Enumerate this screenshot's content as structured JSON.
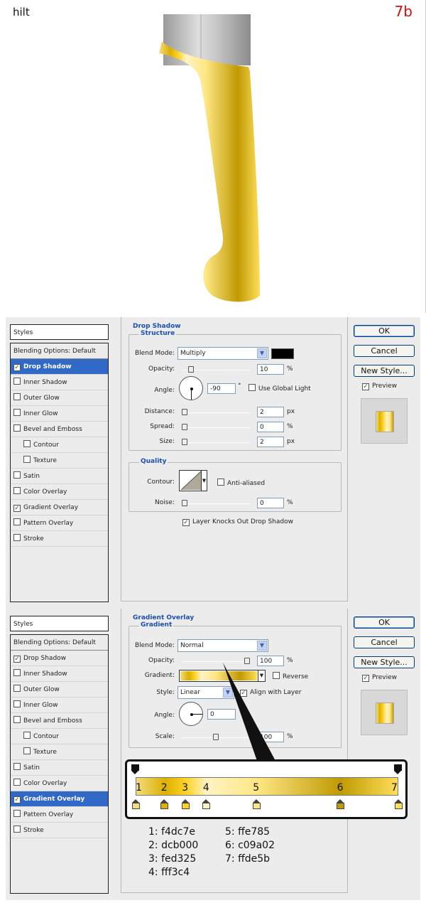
{
  "header": {
    "title": "hilt",
    "step": "7b"
  },
  "colors": {
    "handle": "#f0cc3c",
    "blade": "#c8c8c8",
    "accent": "#d01010"
  },
  "panel1": {
    "styles_header": "Styles",
    "styles": [
      {
        "label": "Blending Options: Default",
        "checked": null,
        "selected": false,
        "sub": false
      },
      {
        "label": "Drop Shadow",
        "checked": true,
        "selected": true,
        "sub": false
      },
      {
        "label": "Inner Shadow",
        "checked": false,
        "selected": false,
        "sub": false
      },
      {
        "label": "Outer Glow",
        "checked": false,
        "selected": false,
        "sub": false
      },
      {
        "label": "Inner Glow",
        "checked": false,
        "selected": false,
        "sub": false
      },
      {
        "label": "Bevel and Emboss",
        "checked": false,
        "selected": false,
        "sub": false
      },
      {
        "label": "Contour",
        "checked": false,
        "selected": false,
        "sub": true
      },
      {
        "label": "Texture",
        "checked": false,
        "selected": false,
        "sub": true
      },
      {
        "label": "Satin",
        "checked": false,
        "selected": false,
        "sub": false
      },
      {
        "label": "Color Overlay",
        "checked": false,
        "selected": false,
        "sub": false
      },
      {
        "label": "Gradient Overlay",
        "checked": true,
        "selected": false,
        "sub": false
      },
      {
        "label": "Pattern Overlay",
        "checked": false,
        "selected": false,
        "sub": false
      },
      {
        "label": "Stroke",
        "checked": false,
        "selected": false,
        "sub": false
      }
    ],
    "section_title": "Drop Shadow",
    "structure_title": "Structure",
    "blend_mode_label": "Blend Mode:",
    "blend_mode": "Multiply",
    "shadow_color": "#000000",
    "opacity_label": "Opacity:",
    "opacity": "10",
    "opacity_level": 0.1,
    "pct": "%",
    "angle_label": "Angle:",
    "angle": "-90",
    "degree": "°",
    "use_global_light": "Use Global Light",
    "distance_label": "Distance:",
    "distance": "2",
    "spread_label": "Spread:",
    "spread": "0",
    "size_label": "Size:",
    "size": "2",
    "px": "px",
    "quality_title": "Quality",
    "contour_label": "Contour:",
    "anti_aliased": "Anti-aliased",
    "noise_label": "Noise:",
    "noise": "0",
    "knockout": "Layer Knocks Out Drop Shadow"
  },
  "panel2": {
    "styles_header": "Styles",
    "styles": [
      {
        "label": "Blending Options: Default",
        "checked": null,
        "selected": false,
        "sub": false
      },
      {
        "label": "Drop Shadow",
        "checked": true,
        "selected": false,
        "sub": false
      },
      {
        "label": "Inner Shadow",
        "checked": false,
        "selected": false,
        "sub": false
      },
      {
        "label": "Outer Glow",
        "checked": false,
        "selected": false,
        "sub": false
      },
      {
        "label": "Inner Glow",
        "checked": false,
        "selected": false,
        "sub": false
      },
      {
        "label": "Bevel and Emboss",
        "checked": false,
        "selected": false,
        "sub": false
      },
      {
        "label": "Contour",
        "checked": false,
        "selected": false,
        "sub": true
      },
      {
        "label": "Texture",
        "checked": false,
        "selected": false,
        "sub": true
      },
      {
        "label": "Satin",
        "checked": false,
        "selected": false,
        "sub": false
      },
      {
        "label": "Color Overlay",
        "checked": false,
        "selected": false,
        "sub": false
      },
      {
        "label": "Gradient Overlay",
        "checked": true,
        "selected": true,
        "sub": false
      },
      {
        "label": "Pattern Overlay",
        "checked": false,
        "selected": false,
        "sub": false
      },
      {
        "label": "Stroke",
        "checked": false,
        "selected": false,
        "sub": false
      }
    ],
    "section_title": "Gradient Overlay",
    "gradient_title": "Gradient",
    "blend_mode_label": "Blend Mode:",
    "blend_mode": "Normal",
    "opacity_label": "Opacity:",
    "opacity": "100",
    "opacity_level": 1.0,
    "pct": "%",
    "gradient_label": "Gradient:",
    "reverse": "Reverse",
    "style_label": "Style:",
    "style": "Linear",
    "align_with_layer": "Align with Layer",
    "angle_label": "Angle:",
    "angle": "0",
    "scale_label": "Scale:",
    "scale": "100",
    "scale_level": 0.5
  },
  "buttons": {
    "ok": "OK",
    "cancel": "Cancel",
    "new_style": "New Style...",
    "preview": "Preview"
  },
  "gradient_stops": [
    {
      "num": "1",
      "hex": "f4dc7e",
      "color": "#f4dc7e",
      "pos": 0.0
    },
    {
      "num": "2",
      "hex": "dcb000",
      "color": "#dcb000",
      "pos": 0.11
    },
    {
      "num": "3",
      "hex": "fed325",
      "color": "#fed325",
      "pos": 0.19
    },
    {
      "num": "4",
      "hex": "fff3c4",
      "color": "#fff3c4",
      "pos": 0.27
    },
    {
      "num": "5",
      "hex": "ffe785",
      "color": "#ffe785",
      "pos": 0.46
    },
    {
      "num": "6",
      "hex": "c09a02",
      "color": "#c09a02",
      "pos": 0.78
    },
    {
      "num": "7",
      "hex": "ffde5b",
      "color": "#ffde5b",
      "pos": 1.0
    }
  ],
  "legend": [
    {
      "label": "1: f4dc7e"
    },
    {
      "label": "2: dcb000"
    },
    {
      "label": "3: fed325"
    },
    {
      "label": "4: fff3c4"
    },
    {
      "label": "5: ffe785"
    },
    {
      "label": "6: c09a02"
    },
    {
      "label": "7: ffde5b"
    }
  ]
}
